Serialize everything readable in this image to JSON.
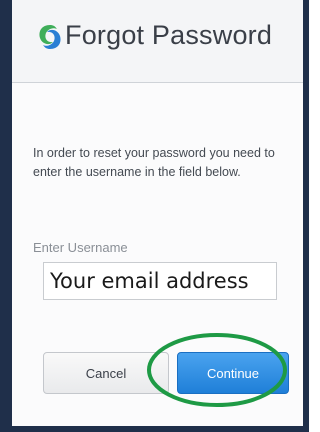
{
  "dialog": {
    "title": "Forgot Password",
    "instructions": "In order to reset your password you need to enter the username in the field below.",
    "username_label": "Enter Username",
    "username_placeholder": "Your email address",
    "username_value": "",
    "cancel_label": "Cancel",
    "continue_label": "Continue"
  },
  "icons": {
    "logo": "swirl-logo-icon"
  },
  "colors": {
    "primary_button": "#2b8de0",
    "highlight": "#1e9a45",
    "frame": "#1f2f4a"
  }
}
